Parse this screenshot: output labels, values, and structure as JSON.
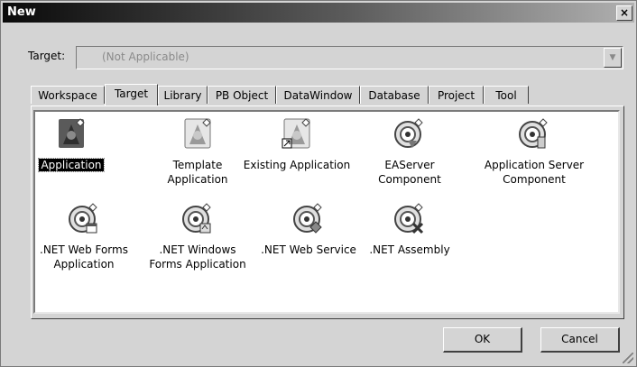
{
  "window": {
    "title": "New",
    "close_glyph": "×"
  },
  "target": {
    "label": "Target:",
    "value": "(Not Applicable)",
    "dropdown_glyph": "▼"
  },
  "tabs": [
    "Workspace",
    "Target",
    "Library",
    "PB Object",
    "DataWindow",
    "Database",
    "Project",
    "Tool"
  ],
  "active_tab": "Target",
  "items": [
    {
      "line1": "Application",
      "line2": "",
      "icon": "application-icon",
      "selected": true
    },
    {
      "line1": "Template",
      "line2": "Application",
      "icon": "template-application-icon"
    },
    {
      "line1": "Existing Application",
      "line2": "",
      "icon": "existing-application-icon"
    },
    {
      "line1": "EAServer",
      "line2": "Component",
      "icon": "easerver-component-icon"
    },
    {
      "line1": "Application Server",
      "line2": "Component",
      "icon": "application-server-component-icon"
    },
    {
      "line1": ".NET Web Forms",
      "line2": "Application",
      "icon": "net-web-forms-icon"
    },
    {
      "line1": ".NET Windows",
      "line2": "Forms Application",
      "icon": "net-windows-forms-icon"
    },
    {
      "line1": ".NET Web Service",
      "line2": "",
      "icon": "net-web-service-icon"
    },
    {
      "line1": ".NET Assembly",
      "line2": "",
      "icon": "net-assembly-icon"
    }
  ],
  "buttons": {
    "ok": "OK",
    "cancel": "Cancel"
  }
}
